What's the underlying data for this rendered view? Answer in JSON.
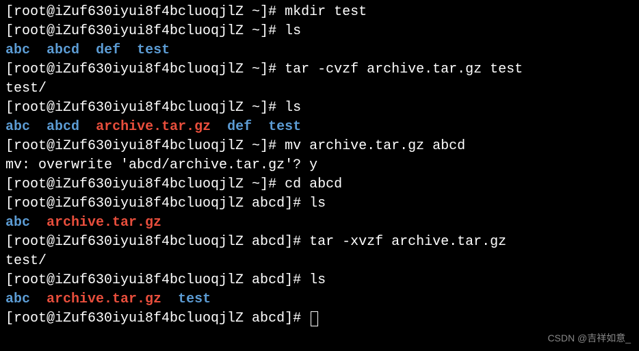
{
  "host": "iZuf630iyui8f4bcluoqjlZ",
  "user": "root",
  "lines": [
    {
      "type": "cmd",
      "path": "~",
      "cmd": "mkdir test"
    },
    {
      "type": "cmd",
      "path": "~",
      "cmd": "ls"
    },
    {
      "type": "ls",
      "items": [
        {
          "text": "abc",
          "cls": "blue"
        },
        {
          "text": "abcd",
          "cls": "blue"
        },
        {
          "text": "def",
          "cls": "blue"
        },
        {
          "text": "test",
          "cls": "blue"
        }
      ]
    },
    {
      "type": "cmd",
      "path": "~",
      "cmd": "tar -cvzf archive.tar.gz test"
    },
    {
      "type": "out",
      "text": "test/"
    },
    {
      "type": "cmd",
      "path": "~",
      "cmd": "ls"
    },
    {
      "type": "ls",
      "items": [
        {
          "text": "abc",
          "cls": "blue"
        },
        {
          "text": "abcd",
          "cls": "blue"
        },
        {
          "text": "archive.tar.gz",
          "cls": "red"
        },
        {
          "text": "def",
          "cls": "blue"
        },
        {
          "text": "test",
          "cls": "blue"
        }
      ]
    },
    {
      "type": "cmd",
      "path": "~",
      "cmd": "mv archive.tar.gz abcd"
    },
    {
      "type": "out",
      "text": "mv: overwrite 'abcd/archive.tar.gz'? y"
    },
    {
      "type": "cmd",
      "path": "~",
      "cmd": "cd abcd"
    },
    {
      "type": "cmd",
      "path": "abcd",
      "cmd": "ls"
    },
    {
      "type": "ls",
      "items": [
        {
          "text": "abc",
          "cls": "blue"
        },
        {
          "text": "archive.tar.gz",
          "cls": "red"
        }
      ]
    },
    {
      "type": "cmd",
      "path": "abcd",
      "cmd": "tar -xvzf archive.tar.gz"
    },
    {
      "type": "out",
      "text": "test/"
    },
    {
      "type": "cmd",
      "path": "abcd",
      "cmd": "ls"
    },
    {
      "type": "ls",
      "items": [
        {
          "text": "abc",
          "cls": "blue"
        },
        {
          "text": "archive.tar.gz",
          "cls": "red"
        },
        {
          "text": "test",
          "cls": "blue"
        }
      ]
    },
    {
      "type": "cmd",
      "path": "abcd",
      "cmd": "",
      "cursor": true
    }
  ],
  "watermark": "CSDN @吉祥如意_"
}
